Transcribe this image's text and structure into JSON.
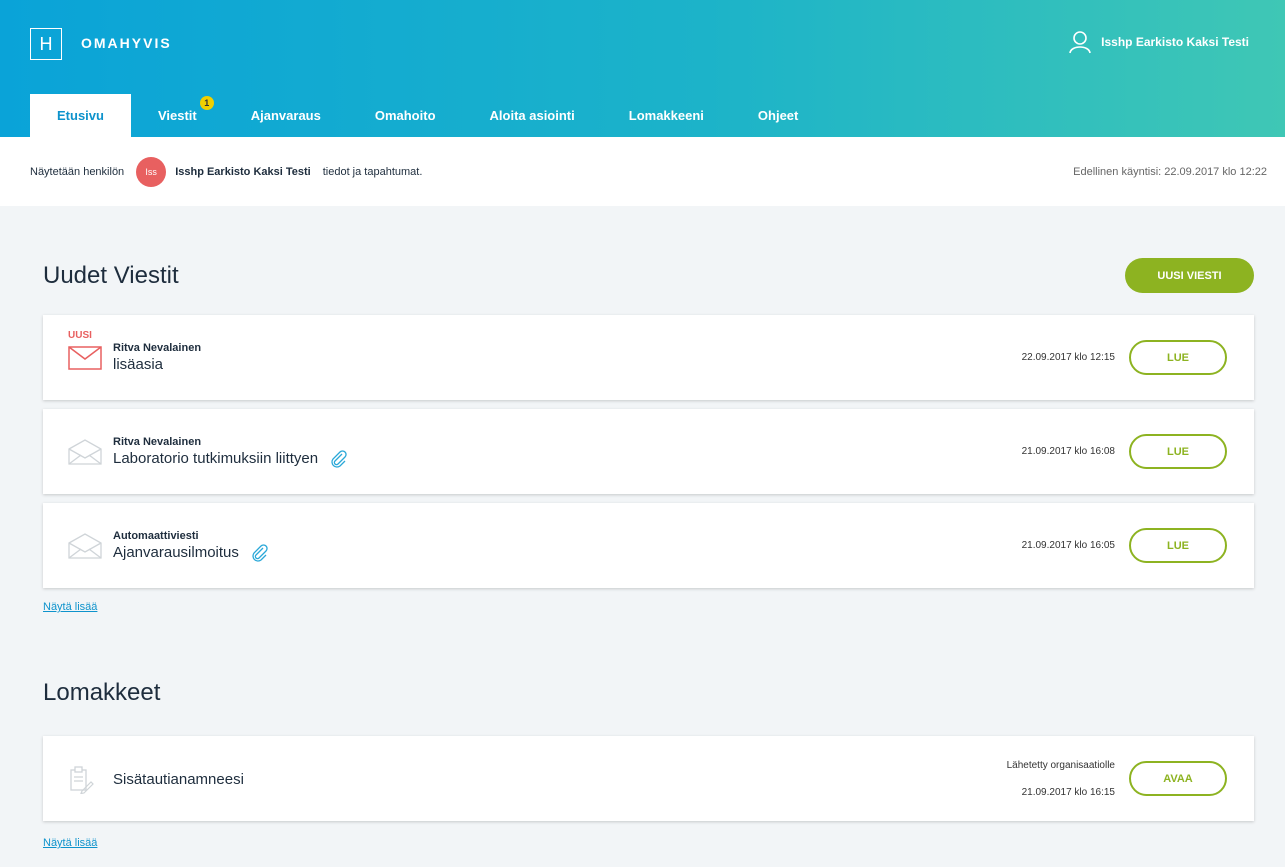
{
  "app": {
    "logo_letter": "H",
    "name": "OMAHYVIS"
  },
  "user": {
    "name": "Isshp Earkisto Kaksi Testi"
  },
  "tabs": [
    {
      "label": "Etusivu",
      "active": true
    },
    {
      "label": "Viestit",
      "badge": "1"
    },
    {
      "label": "Ajanvaraus"
    },
    {
      "label": "Omahoito"
    },
    {
      "label": "Aloita asiointi"
    },
    {
      "label": "Lomakkeeni"
    },
    {
      "label": "Ohjeet"
    }
  ],
  "info": {
    "prefix": "Näytetään henkilön",
    "avatar": "Iss",
    "name": "Isshp Earkisto Kaksi Testi",
    "suffix": "tiedot ja tapahtumat.",
    "last_visit": "Edellinen käyntisi: 22.09.2017 klo 12:22"
  },
  "messages": {
    "title": "Uudet Viestit",
    "new_button": "UUSI VIESTI",
    "new_label": "UUSI",
    "items": [
      {
        "sender": "Ritva Nevalainen",
        "subject": "lisäasia",
        "date": "22.09.2017 klo 12:15",
        "action": "LUE",
        "is_new": true,
        "attachment": false
      },
      {
        "sender": "Ritva Nevalainen",
        "subject": "Laboratorio tutkimuksiin liittyen",
        "date": "21.09.2017 klo 16:08",
        "action": "LUE",
        "is_new": false,
        "attachment": true
      },
      {
        "sender": "Automaattiviesti",
        "subject": "Ajanvarausilmoitus",
        "date": "21.09.2017 klo 16:05",
        "action": "LUE",
        "is_new": false,
        "attachment": true
      }
    ],
    "show_more": "Näytä lisää"
  },
  "forms": {
    "title": "Lomakkeet",
    "items": [
      {
        "name": "Sisätautianamneesi",
        "status": "Lähetetty organisaatiolle",
        "date": "21.09.2017 klo 16:15",
        "action": "AVAA"
      }
    ],
    "show_more": "Näytä lisää"
  },
  "colors": {
    "accent_green": "#8db321",
    "header_blue": "#0aa3d8",
    "header_teal": "#3fc7b5",
    "new_red": "#e86060"
  }
}
